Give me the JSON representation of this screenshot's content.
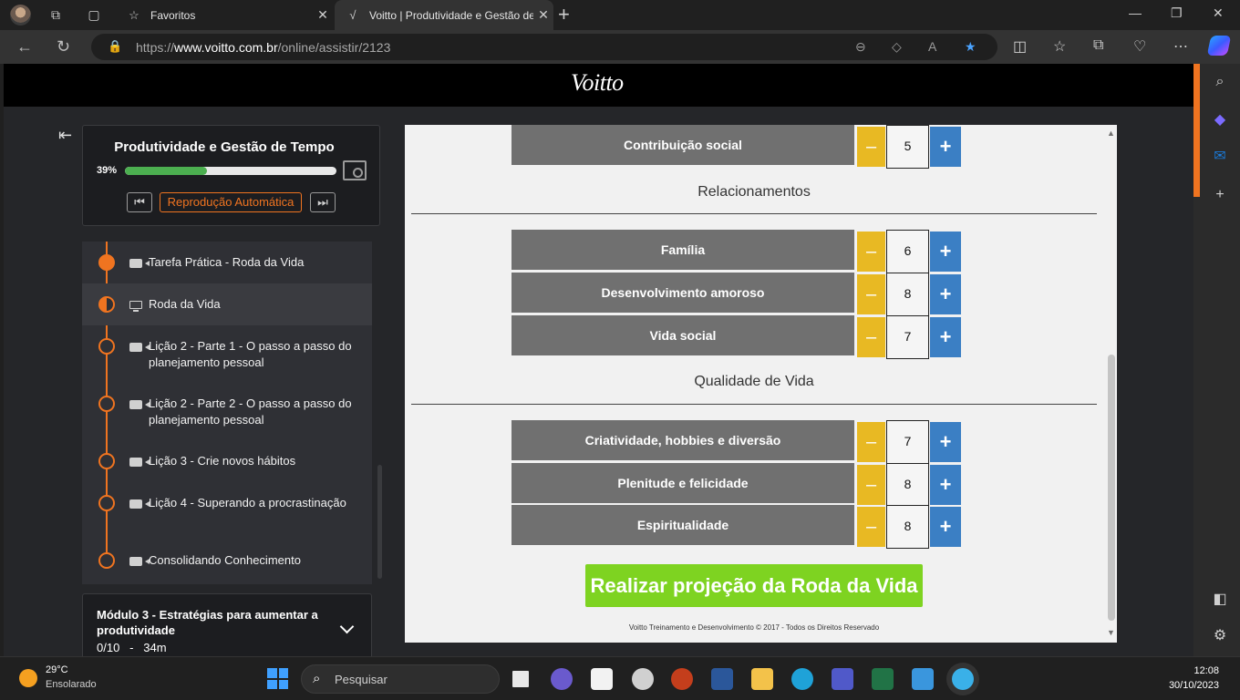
{
  "browser": {
    "tabs": [
      {
        "title": "Favoritos",
        "active": false
      },
      {
        "title": "Voitto | Produtividade e Gestão de Tempo",
        "active": true
      }
    ],
    "url_prefix": "https://",
    "url_domain": "www.voitto.com.br",
    "url_path": "/online/assistir/2123"
  },
  "site": {
    "logo": "Voitto"
  },
  "course": {
    "title": "Produtividade e Gestão de Tempo",
    "progress_label": "39%",
    "progress_fraction": 0.39,
    "autoplay_label": "Reprodução Automática"
  },
  "lessons": [
    {
      "label": "Tarefa Prática - Roda da Vida",
      "status": "done",
      "icon": "video-icon"
    },
    {
      "label": "Roda da Vida",
      "status": "current",
      "icon": "monitor-icon"
    },
    {
      "label": "Lição 2 - Parte 1 - O passo a passo do planejamento pessoal",
      "status": "todo",
      "icon": "video-icon"
    },
    {
      "label": "Lição 2 - Parte 2 - O passo a passo do planejamento pessoal",
      "status": "todo",
      "icon": "video-icon"
    },
    {
      "label": "Lição 3 - Crie novos hábitos",
      "status": "todo",
      "icon": "video-icon"
    },
    {
      "label": "Lição 4 - Superando a procrastinação",
      "status": "todo",
      "icon": "video-icon"
    },
    {
      "label": "Consolidando Conhecimento",
      "status": "todo",
      "icon": "video-icon"
    }
  ],
  "module": {
    "title": "Módulo 3 - Estratégias para aumentar a produtividade",
    "meta": "0/10   -   34m"
  },
  "wheel": {
    "top_row": {
      "label": "Contribuição social",
      "value": "5"
    },
    "sections": [
      {
        "title": "Relacionamentos",
        "rows": [
          {
            "label": "Família",
            "value": "6"
          },
          {
            "label": "Desenvolvimento amoroso",
            "value": "8"
          },
          {
            "label": "Vida social",
            "value": "7"
          }
        ]
      },
      {
        "title": "Qualidade de Vida",
        "rows": [
          {
            "label": "Criatividade, hobbies e diversão",
            "value": "7"
          },
          {
            "label": "Plenitude e felicidade",
            "value": "8"
          },
          {
            "label": "Espiritualidade",
            "value": "8"
          }
        ]
      }
    ],
    "minus_symbol": "–",
    "plus_symbol": "+",
    "cta_label": "Realizar projeção da Roda da Vida",
    "footer": "Voitto Treinamento e Desenvolvimento © 2017 - Todos os Direitos Reservado"
  },
  "taskbar": {
    "temperature": "29°C",
    "weather": "Ensolarado",
    "search_placeholder": "Pesquisar",
    "time": "12:08",
    "date": "30/10/2023"
  },
  "colors": {
    "accent_orange": "#f07420",
    "minus_yellow": "#e8b923",
    "plus_blue": "#3b7fc4",
    "cta_green": "#7ed321",
    "progress_green": "#4caf50"
  }
}
